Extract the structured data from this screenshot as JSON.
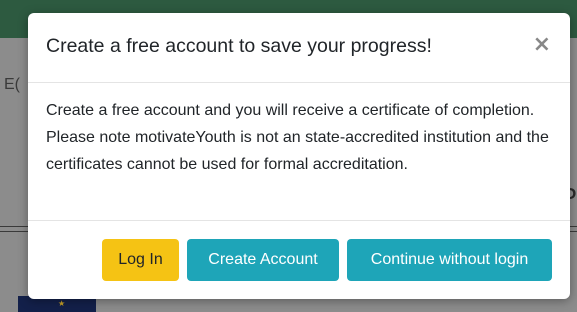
{
  "background": {
    "left_fragment": "E(",
    "right_fragment": "P"
  },
  "modal": {
    "title": "Create a free account to save your progress!",
    "close_label": "×",
    "body": "Create a free account and you will receive a certificate of completion. Please note motivateYouth is not an state-accredited institution and the certificates cannot be used for formal accreditation.",
    "buttons": {
      "login": "Log In",
      "create": "Create Account",
      "continue": "Continue without login"
    }
  },
  "colors": {
    "header_green": "#2d5a40",
    "login_yellow": "#f5c314",
    "action_teal": "#1ea5b8"
  }
}
